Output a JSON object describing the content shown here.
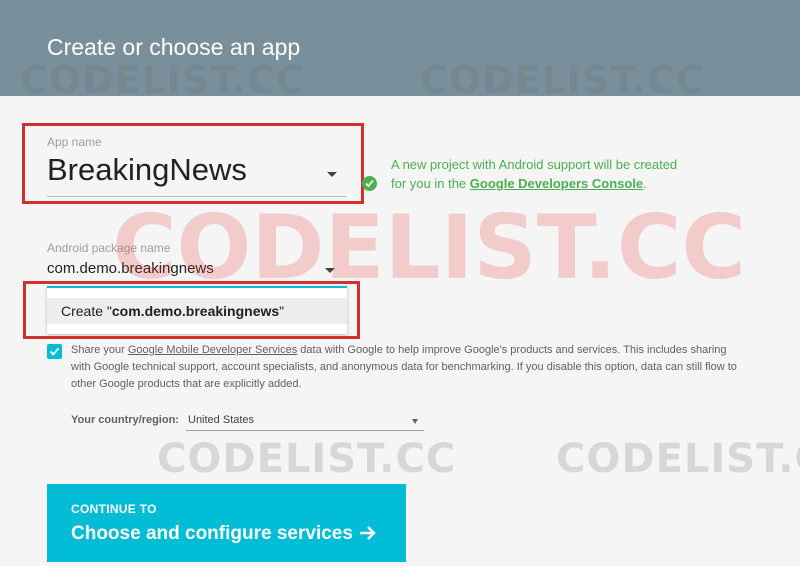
{
  "header": {
    "title": "Create or choose an app"
  },
  "app_name": {
    "label": "App name",
    "value": "BreakingNews"
  },
  "info": {
    "text_before": "A new project with Android support will be created for you in the ",
    "link": "Google Developers Console",
    "text_after": "."
  },
  "package": {
    "label": "Android package name",
    "value": "com.demo.breakingnews",
    "suggestion_prefix": "Create \"",
    "suggestion_value": "com.demo.breakingnews",
    "suggestion_suffix": "\""
  },
  "share": {
    "checked": true,
    "text_before": "Share your ",
    "link": "Google Mobile Developer Services",
    "text_after": " data with Google to help improve Google's products and services. This includes sharing with Google technical support, account specialists, and anonymous data for benchmarking. If you disable this option, data can still flow to other Google products that are explicitly added."
  },
  "country": {
    "label": "Your country/region:",
    "value": "United States"
  },
  "continue": {
    "small": "CONTINUE TO",
    "big": "Choose and configure services"
  },
  "watermarks": {
    "small": "CODELIST.CC",
    "big": "CODELIST.CC"
  },
  "colors": {
    "header_bg": "#78909c",
    "accent": "#00bcd4",
    "success": "#4caf50",
    "highlight_box": "#d32f2f"
  }
}
